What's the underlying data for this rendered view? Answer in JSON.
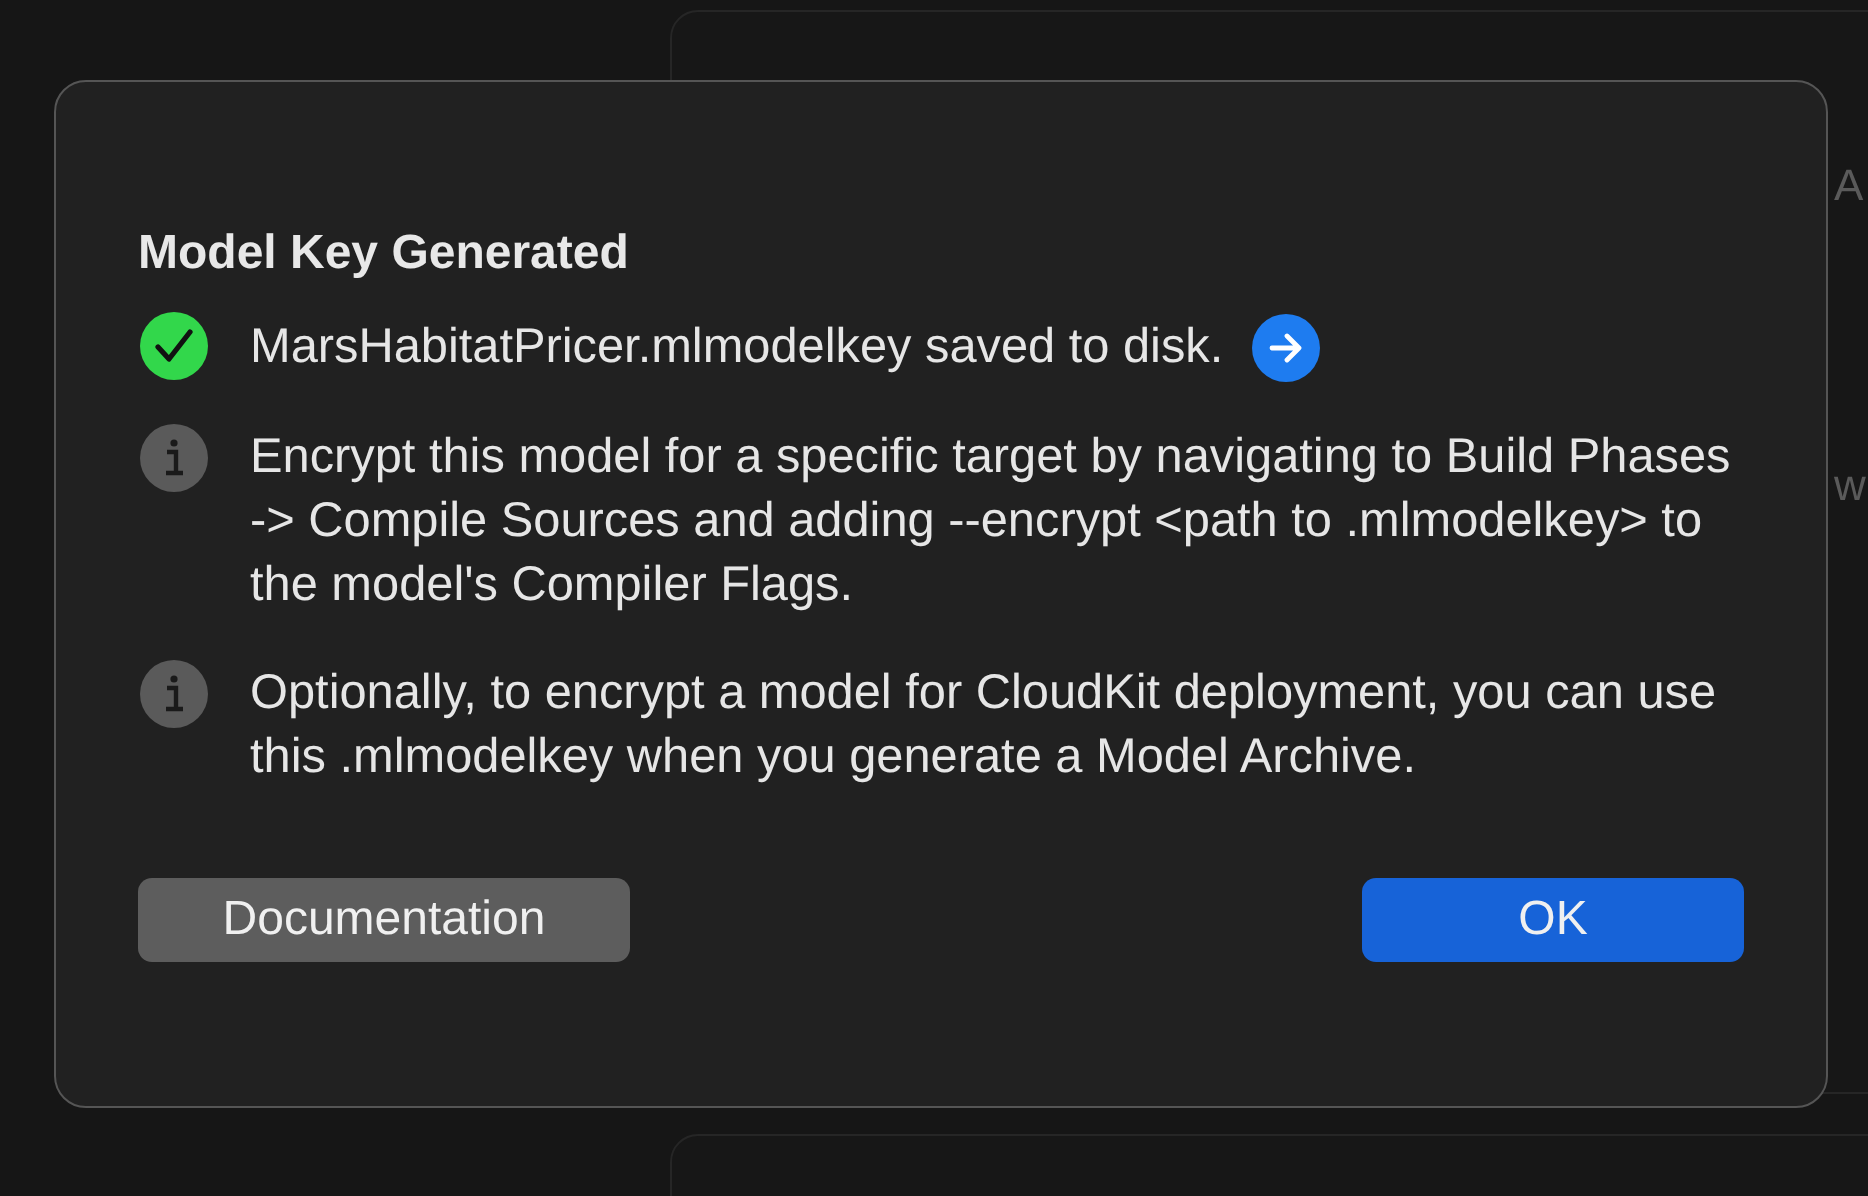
{
  "background": {
    "texts": [
      "A",
      "w"
    ]
  },
  "dialog": {
    "title": "Model Key Generated",
    "messages": [
      {
        "kind": "success",
        "text": "MarsHabitatPricer.mlmodelkey saved to disk.",
        "arrow_button": true
      },
      {
        "kind": "info",
        "text": "Encrypt this model for a specific target by navigating to Build Phases -> Compile Sources and adding --encrypt <path to .mlmodelkey> to the model's Compiler Flags.",
        "arrow_button": false
      },
      {
        "kind": "info",
        "text": "Optionally, to encrypt a model for CloudKit deployment, you can use this .mlmodelkey when you generate a Model Archive.",
        "arrow_button": false
      }
    ],
    "buttons": [
      {
        "label": "Documentation",
        "kind": "secondary"
      },
      {
        "label": "OK",
        "kind": "primary"
      }
    ]
  }
}
